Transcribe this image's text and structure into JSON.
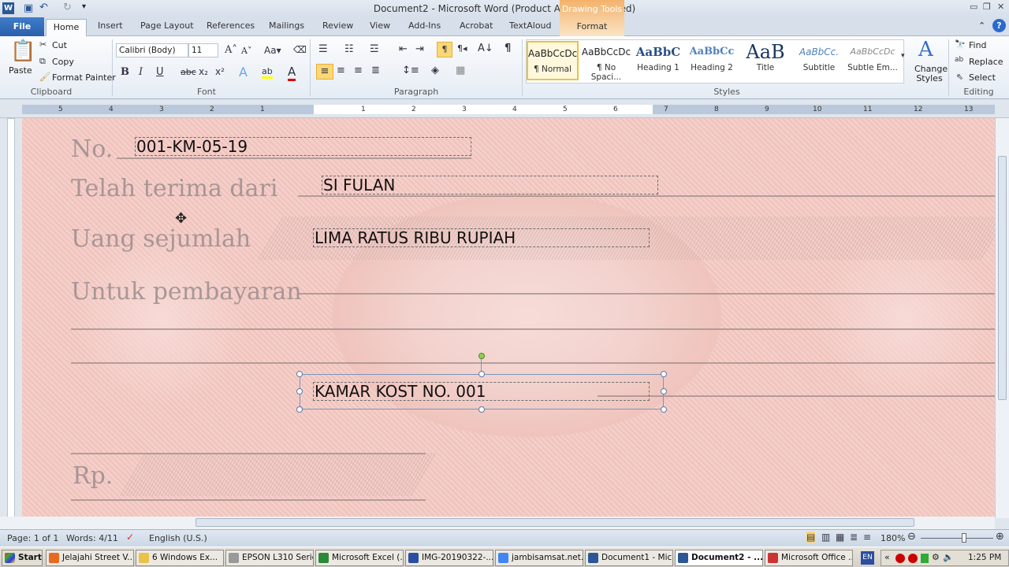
{
  "window": {
    "title": "Document2 - Microsoft Word (Product Activation Failed)"
  },
  "tabs": {
    "file": "File",
    "items": [
      "Home",
      "Insert",
      "Page Layout",
      "References",
      "Mailings",
      "Review",
      "View",
      "Add-Ins",
      "Acrobat",
      "TextAloud"
    ],
    "contextual_group": "Drawing Tools",
    "contextual_tab": "Format"
  },
  "ribbon": {
    "clipboard": {
      "paste": "Paste",
      "cut": "Cut",
      "copy": "Copy",
      "format_painter": "Format Painter",
      "label": "Clipboard"
    },
    "font": {
      "font_name": "Calibri (Body)",
      "font_size": "11",
      "label": "Font"
    },
    "paragraph": {
      "label": "Paragraph"
    },
    "styles": {
      "items": [
        {
          "preview": "AaBbCcDc",
          "name": "¶ Normal"
        },
        {
          "preview": "AaBbCcDc",
          "name": "¶ No Spaci..."
        },
        {
          "preview": "AaBbC",
          "name": "Heading 1"
        },
        {
          "preview": "AaBbCc",
          "name": "Heading 2"
        },
        {
          "preview": "AaB",
          "name": "Title"
        },
        {
          "preview": "AaBbCc.",
          "name": "Subtitle"
        },
        {
          "preview": "AaBbCcDc",
          "name": "Subtle Em..."
        }
      ],
      "change_styles": "Change Styles",
      "label": "Styles"
    },
    "editing": {
      "find": "Find",
      "replace": "Replace",
      "select": "Select",
      "label": "Editing"
    }
  },
  "ruler": {
    "left": [
      "5",
      "4",
      "3",
      "2",
      "1"
    ],
    "right": [
      "1",
      "2",
      "3",
      "4",
      "5",
      "6",
      "7",
      "8",
      "9",
      "10",
      "11",
      "12",
      "13"
    ]
  },
  "document": {
    "form_labels": {
      "no": "No.",
      "received_from": "Telah terima dari",
      "amount": "Uang sejumlah",
      "payment_for": "Untuk pembayaran",
      "rp": "Rp."
    },
    "fields": {
      "number": "001-KM-05-19",
      "received_from": "SI FULAN",
      "amount": "LIMA RATUS RIBU RUPIAH",
      "payment_for": "KAMAR KOST NO. 001"
    }
  },
  "status": {
    "page": "Page: 1 of 1",
    "words": "Words: 4/11",
    "language": "English (U.S.)",
    "zoom": "180%",
    "zoom_percent": 180
  },
  "taskbar": {
    "start": "Start",
    "items": [
      "Jelajahi Street V...",
      "6 Windows Ex...",
      "EPSON L310 Series",
      "Microsoft Excel (...",
      "IMG-20190322-...",
      "jambisamsat.net...",
      "Document1 - Mic...",
      "Document2 - ...",
      "Microsoft Office ..."
    ],
    "active_index": 7,
    "lang": "EN",
    "clock": "1:25 PM"
  },
  "colors": {
    "accent": "#2a5fab",
    "contextual": "#f3b26b",
    "doc_bg": "#f3d2cd"
  }
}
